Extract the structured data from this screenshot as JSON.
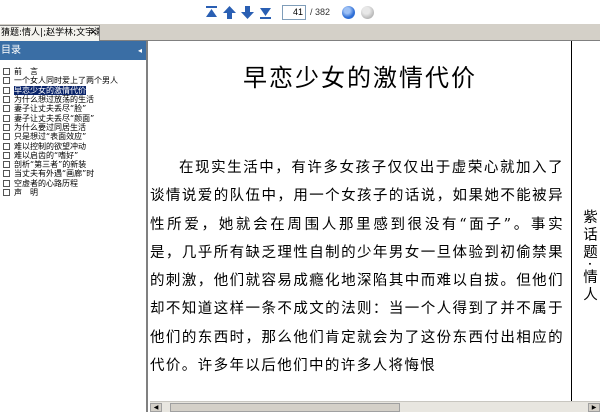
{
  "toolbar": {
    "first_page_icon": "first-page-icon",
    "prev_page_icon": "previous-page-icon",
    "next_page_icon": "next-page-icon",
    "last_page_icon": "last-page-icon",
    "current_page": "41",
    "total_pages": "/ 382",
    "go_button_color": "#2f6fd6"
  },
  "tab": {
    "label": "猜题:情人|;赵学林;文宇漱",
    "close_label": "✕"
  },
  "sidebar": {
    "title": "目录",
    "collapse_label": "◂",
    "items": [
      {
        "label": "前　言"
      },
      {
        "label": "一个女人同时爱上了两个男人"
      },
      {
        "label": "早恋少女的激情代价"
      },
      {
        "label": "为什么想过放荡的生活"
      },
      {
        "label": "妻子让丈夫丢尽“脸”"
      },
      {
        "label": "妻子让丈夫丢尽“颜面”"
      },
      {
        "label": "为什么要过同居生活"
      },
      {
        "label": "只是想过“表面效应”"
      },
      {
        "label": "难以控制的欲望冲动"
      },
      {
        "label": "难以启齿的“嗜好”"
      },
      {
        "label": "剖析“第三者”的新装"
      },
      {
        "label": "当丈夫有外遇“画廊”时"
      },
      {
        "label": "空虚者的心路历程"
      },
      {
        "label": "声　明"
      }
    ],
    "active_index": 2
  },
  "document": {
    "title": "早恋少女的激情代价",
    "side_title": "紫话题·情人",
    "body": "在现实生活中，有许多女孩子仅仅出于虚荣心就加入了谈情说爱的队伍中，用一个女孩子的话说，如果她不能被异性所爱，她就会在周围人那里感到很没有“面子”。事实是，几乎所有缺乏理性自制的少年男女一旦体验到初偷禁果的刺激，他们就容易成瘾化地深陷其中而难以自拔。但他们却不知道这样一条不成文的法则：当一个人得到了并不属于他们的东西时，那么他们肯定就会为了这份东西付出相应的代价。许多年以后他们中的许多人将悔恨"
  },
  "colors": {
    "sidebar_header": "#3a6ea5",
    "selection": "#0a246a",
    "nav_icon": "#2a5fb3"
  }
}
